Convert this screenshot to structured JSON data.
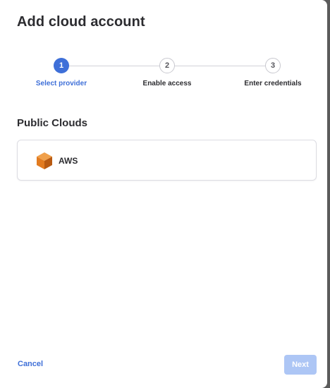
{
  "dialog": {
    "title": "Add cloud account"
  },
  "stepper": {
    "steps": [
      {
        "number": "1",
        "label": "Select provider",
        "state": "active"
      },
      {
        "number": "2",
        "label": "Enable access",
        "state": "inactive"
      },
      {
        "number": "3",
        "label": "Enter credentials",
        "state": "inactive"
      }
    ]
  },
  "section": {
    "title": "Public Clouds",
    "providers": [
      {
        "label": "AWS",
        "icon": "aws-cube-icon"
      }
    ]
  },
  "footer": {
    "cancel_label": "Cancel",
    "next_label": "Next"
  },
  "colors": {
    "accent": "#3e6fd8",
    "next_disabled": "#adc6f5",
    "aws_orange": "#e27b20"
  }
}
